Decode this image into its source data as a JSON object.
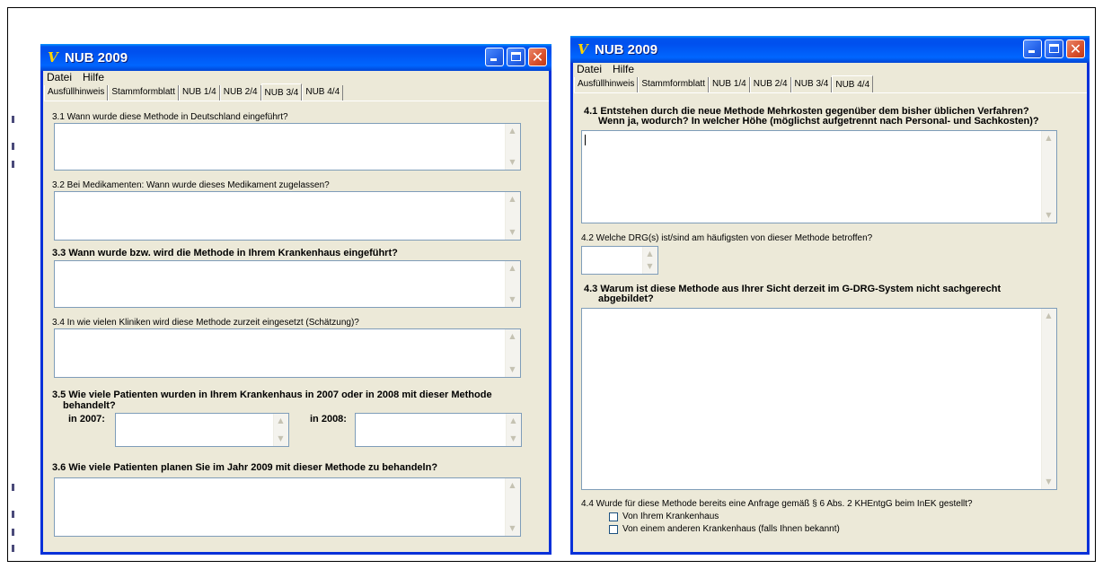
{
  "left_window": {
    "title": "NUB 2009",
    "icon": "nub-logo-icon",
    "menu": [
      "Datei",
      "Hilfe"
    ],
    "tabs": [
      "Ausfüllhinweis",
      "Stammformblatt",
      "NUB 1/4",
      "NUB 2/4",
      "NUB 3/4",
      "NUB 4/4"
    ],
    "active_tab": "NUB 3/4",
    "q31": "3.1 Wann wurde diese Methode in Deutschland eingeführt?",
    "q32": "3.2 Bei Medikamenten: Wann wurde dieses Medikament zugelassen?",
    "q33": "3.3 Wann wurde bzw. wird die Methode in Ihrem Krankenhaus eingeführt?",
    "q34": "3.4 In wie vielen Kliniken wird diese Methode zurzeit eingesetzt (Schätzung)?",
    "q35_line1": "3.5 Wie viele Patienten wurden in Ihrem Krankenhaus in 2007 oder in 2008 mit dieser Methode",
    "q35_line2": "behandelt?",
    "label_2007": "in 2007:",
    "label_2008": "in 2008:",
    "q36": "3.6 Wie viele Patienten planen Sie im Jahr 2009 mit dieser Methode zu behandeln?"
  },
  "right_window": {
    "title": "NUB 2009",
    "icon": "nub-logo-icon",
    "menu": [
      "Datei",
      "Hilfe"
    ],
    "tabs": [
      "Ausfüllhinweis",
      "Stammformblatt",
      "NUB 1/4",
      "NUB 2/4",
      "NUB 3/4",
      "NUB 4/4"
    ],
    "active_tab": "NUB 4/4",
    "q41_line1": "4.1 Entstehen durch die neue Methode Mehrkosten gegenüber dem bisher üblichen Verfahren?",
    "q41_line2": "Wenn ja, wodurch? In welcher Höhe (möglichst aufgetrennt nach Personal- und Sachkosten)?",
    "q42": "4.2 Welche DRG(s) ist/sind am häufigsten von dieser Methode betroffen?",
    "q43_line1": "4.3 Warum ist diese Methode aus Ihrer Sicht derzeit im G-DRG-System nicht sachgerecht",
    "q43_line2": "abgebildet?",
    "q44": "4.4 Wurde für diese Methode bereits eine Anfrage gemäß § 6 Abs. 2 KHEntgG beim InEK gestellt?",
    "cb1": "Von Ihrem Krankenhaus",
    "cb2": "Von einem anderen Krankenhaus (falls Ihnen bekannt)"
  },
  "colors": {
    "title_blue": "#0054e3",
    "window_face": "#ece9d8",
    "close_red": "#d8502c",
    "field_border": "#7f9db9"
  }
}
